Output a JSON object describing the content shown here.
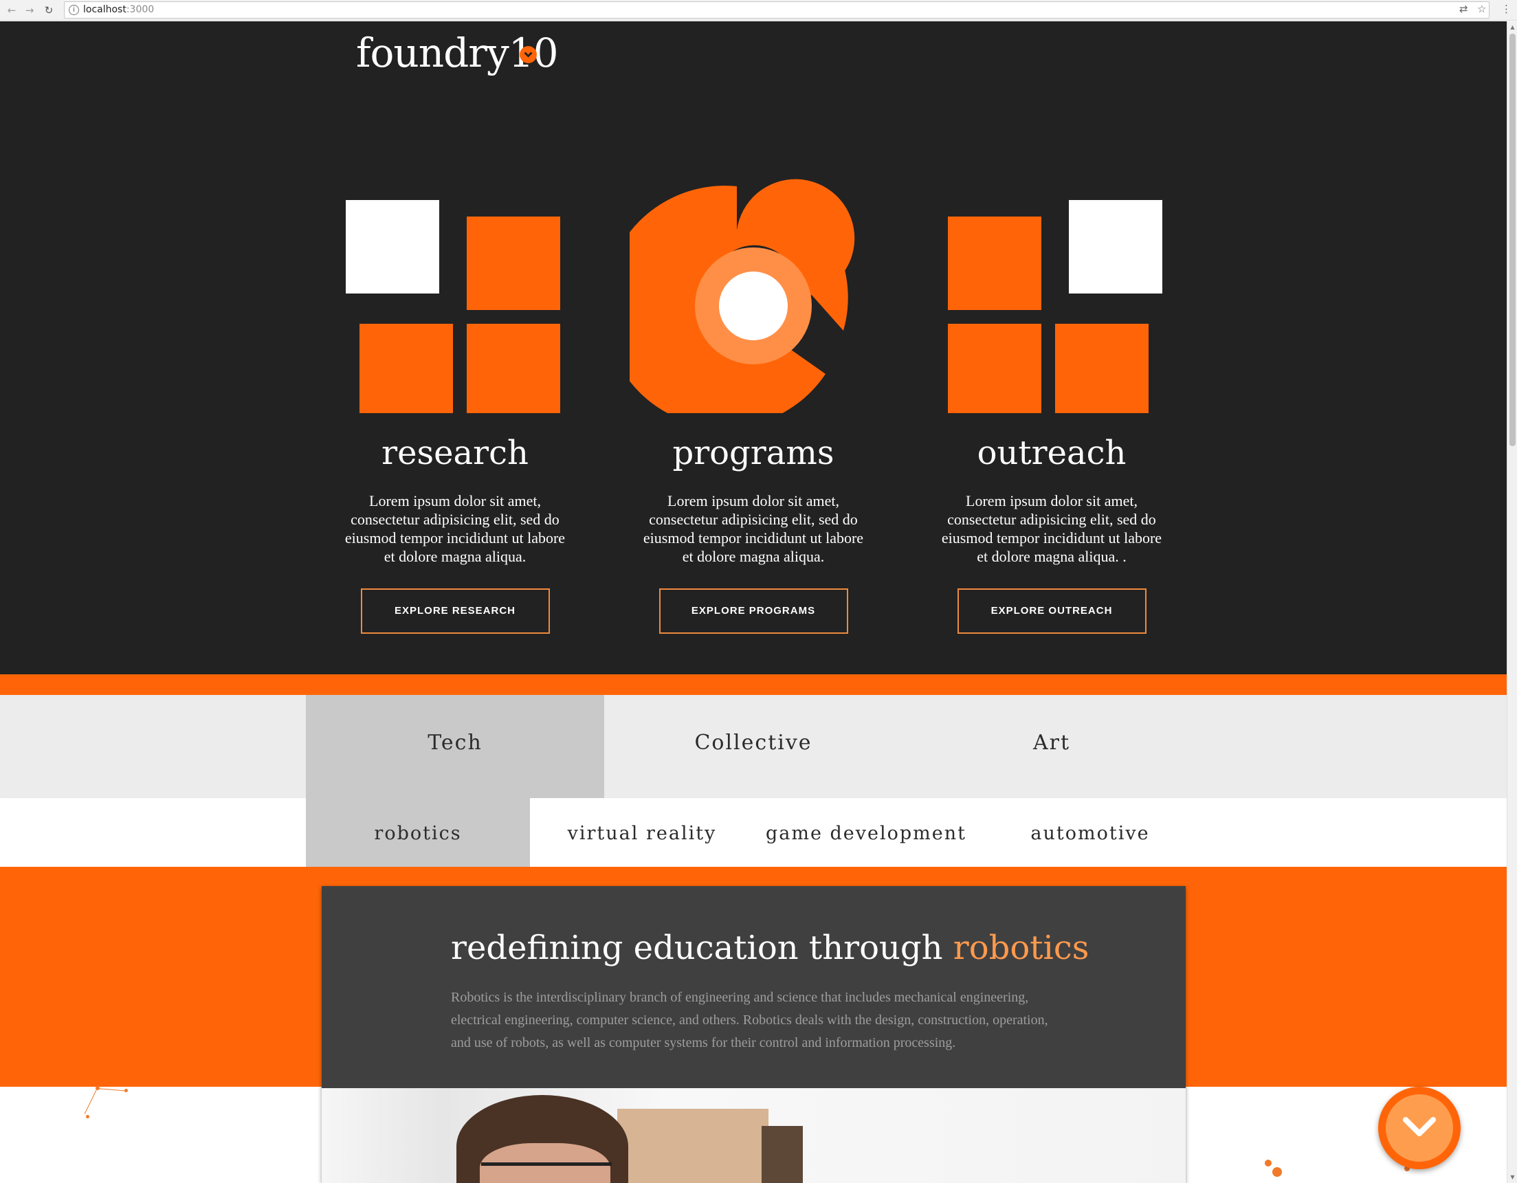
{
  "browser": {
    "url_host": "localhost",
    "url_port": ":3000",
    "back_icon": "arrow-left-icon",
    "forward_icon": "arrow-right-icon",
    "reload_icon": "reload-icon",
    "translate_icon": "translate-icon",
    "bookmark_icon": "star-icon",
    "menu_icon": "kebab-menu-icon"
  },
  "header": {
    "logo": "foundry10",
    "toggle_icon": "chevron-down-icon"
  },
  "pillars": [
    {
      "title": "research",
      "text": "Lorem ipsum dolor sit amet, consectetur adipisicing elit, sed do eiusmod tempor incididunt ut labore et dolore magna aliqua.",
      "button": "EXPLORE RESEARCH"
    },
    {
      "title": "programs",
      "text": "Lorem ipsum dolor sit amet, consectetur adipisicing elit, sed do eiusmod tempor incididunt ut labore et dolore magna aliqua.",
      "button": "EXPLORE PROGRAMS"
    },
    {
      "title": "outreach",
      "text": "Lorem ipsum dolor sit amet, consectetur adipisicing elit, sed do eiusmod tempor incididunt ut labore et dolore magna aliqua. .",
      "button": "EXPLORE OUTREACH"
    }
  ],
  "categories": {
    "items": [
      "Tech",
      "Collective",
      "Art"
    ],
    "active": "Tech"
  },
  "subcategories": {
    "items": [
      "robotics",
      "virtual reality",
      "game development",
      "automotive"
    ],
    "active": "robotics"
  },
  "feature": {
    "title_prefix": "redefining education through ",
    "title_accent": "robotics",
    "text": "Robotics is the interdisciplinary branch of engineering and science that includes mechanical engineering, electrical engineering, computer science, and others. Robotics deals with the design, construction, operation, and use of robots, as well as computer systems for their control and information processing."
  },
  "scroll_button_icon": "chevron-down-icon",
  "colors": {
    "orange": "#ff6508",
    "light_orange": "#ff9a4d",
    "dark": "#222222",
    "card": "#404040",
    "tab_active": "#c9c9c9"
  }
}
